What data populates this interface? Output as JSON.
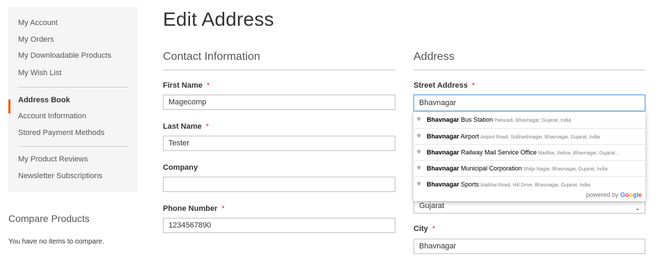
{
  "sidebar": {
    "nav": [
      {
        "label": "My Account"
      },
      {
        "label": "My Orders"
      },
      {
        "label": "My Downloadable Products"
      },
      {
        "label": "My Wish List"
      },
      {
        "label": "Address Book"
      },
      {
        "label": "Account Information"
      },
      {
        "label": "Stored Payment Methods"
      },
      {
        "label": "My Product Reviews"
      },
      {
        "label": "Newsletter Subscriptions"
      }
    ],
    "active_index": 4,
    "accent_color": "#ff5501",
    "compare_title": "Compare Products",
    "compare_empty": "You have no items to compare."
  },
  "page_title": "Edit Address",
  "contact": {
    "title": "Contact Information",
    "first_name_label": "First Name",
    "first_name_value": "Magecomp",
    "last_name_label": "Last Name",
    "last_name_value": "Tester",
    "company_label": "Company",
    "company_value": "",
    "phone_label": "Phone Number",
    "phone_value": "1234567890"
  },
  "address": {
    "title": "Address",
    "street_label": "Street Address",
    "street_value": "Bhavnagar",
    "state_value": "Gujarat",
    "city_label": "City",
    "city_value": "Bhavnagar"
  },
  "required_marker": "*",
  "autocomplete": {
    "suggestions": [
      {
        "match": "Bhavnagar",
        "rest": " Bus Station",
        "secondary": "Panwadi, Bhavnagar, Gujarat, India"
      },
      {
        "match": "Bhavnagar",
        "rest": " Airport",
        "secondary": "Airport Road, Subhashnagar, Bhavnagar, Gujarat, India"
      },
      {
        "match": "Bhavnagar",
        "rest": " Railway Mail Service Office",
        "secondary": "Madhia, Vadva, Bhavnagar, Gujarat..."
      },
      {
        "match": "Bhavnagar",
        "rest": " Municipal Corporation",
        "secondary": "Shilpi Nagar, Bhavnagar, Gujarat, India"
      },
      {
        "match": "Bhavnagar",
        "rest": " Sports",
        "secondary": "Atabhai Road, Hill Drive, Bhavnagar, Gujarat, India"
      }
    ],
    "powered_by": "powered by",
    "google_letters": [
      "G",
      "o",
      "o",
      "g",
      "l",
      "e"
    ]
  }
}
